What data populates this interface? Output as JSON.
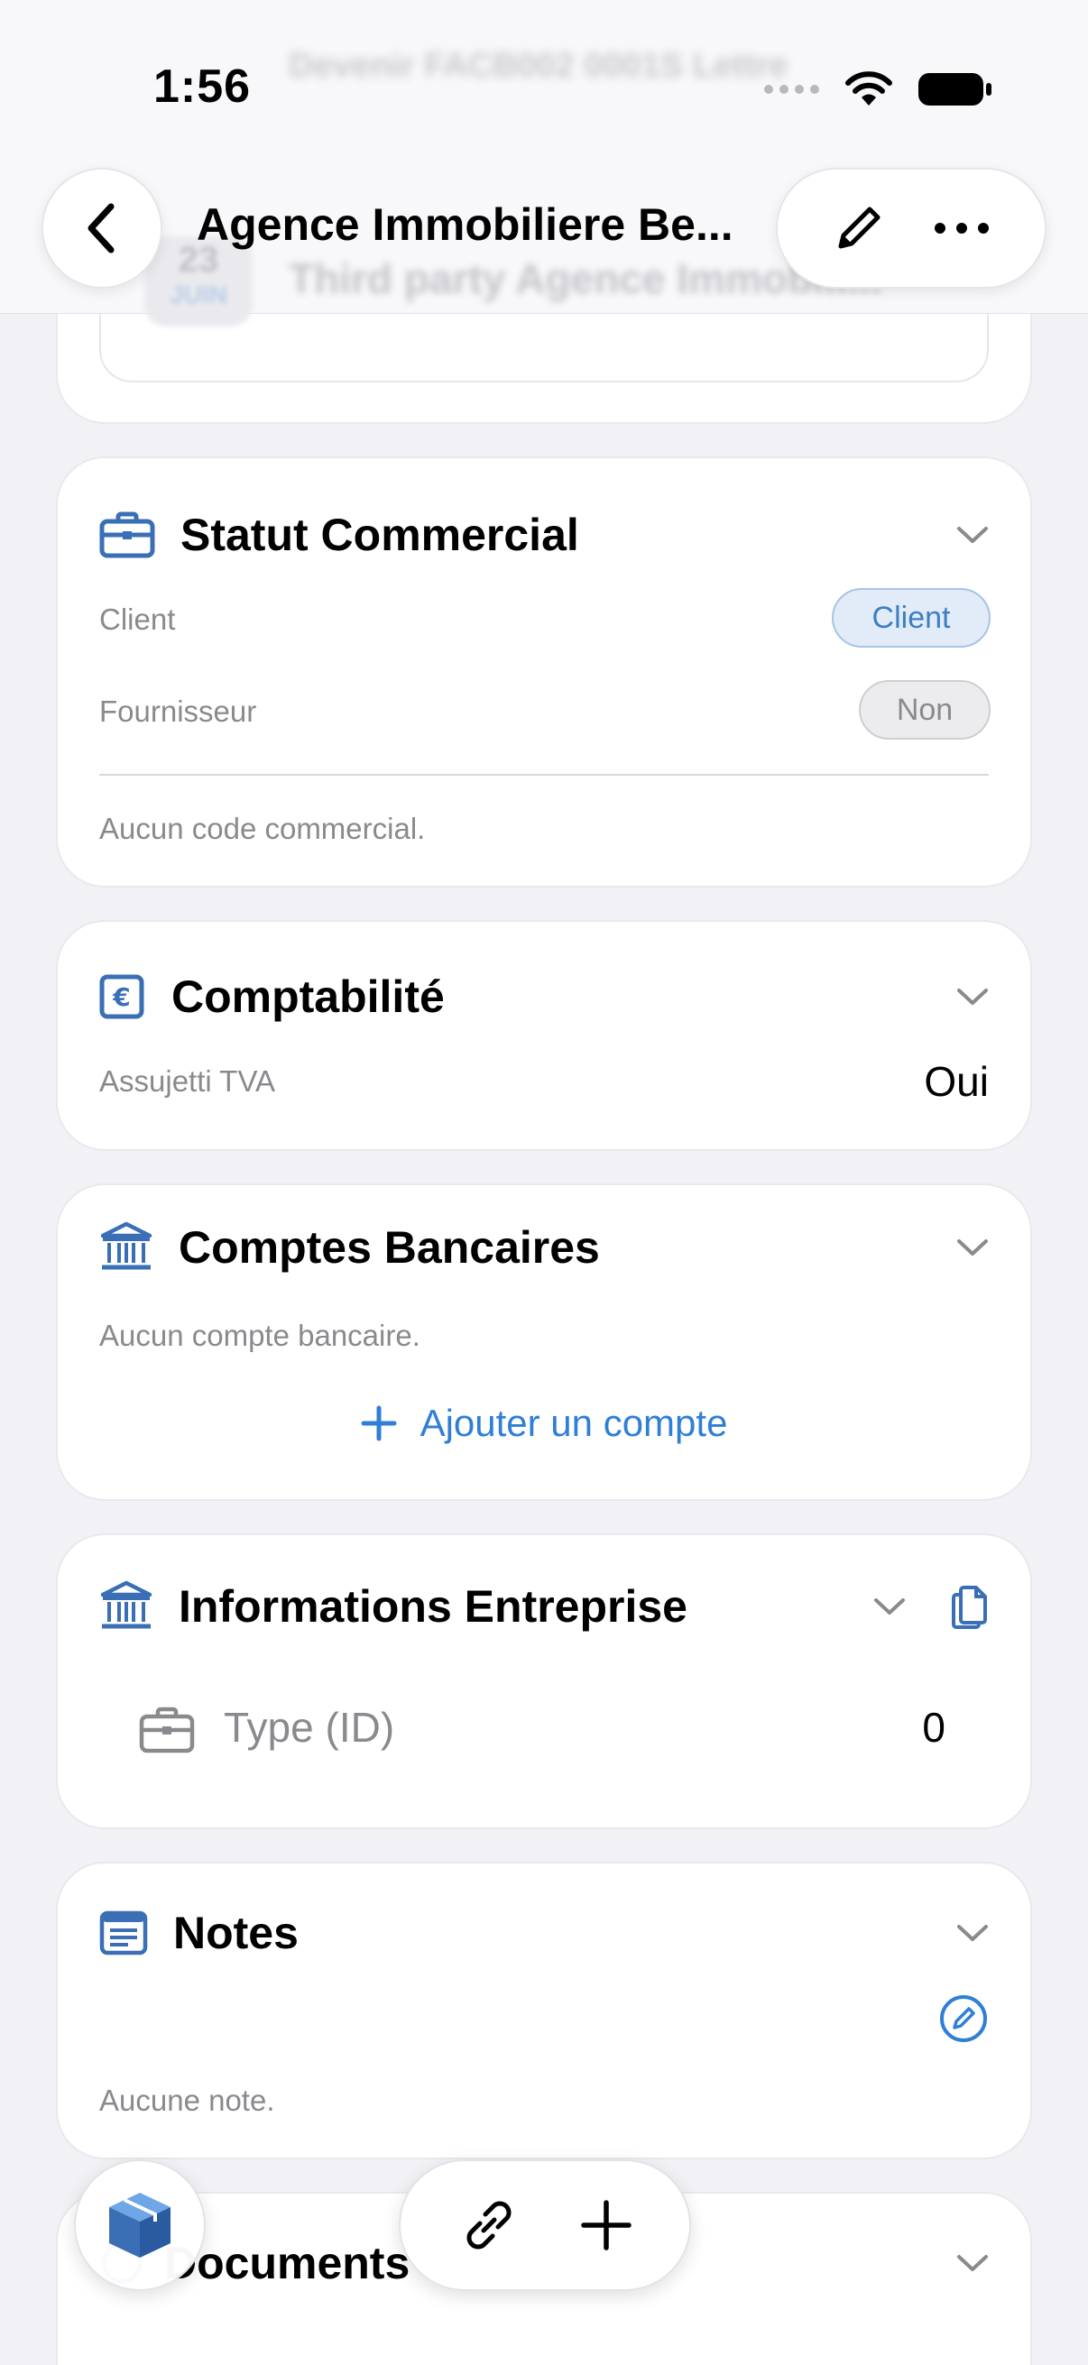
{
  "status_bar": {
    "time": "1:56"
  },
  "header": {
    "title": "Agence Immobiliere Be...",
    "ghost_line1": "Devenir FACB002 0001S Lettre",
    "ghost_line2": "Third party Agence Immobili...",
    "ghost_date_day": "23",
    "ghost_date_month": "JUIN"
  },
  "commercial": {
    "title": "Statut Commercial",
    "client_label": "Client",
    "client_value": "Client",
    "supplier_label": "Fournisseur",
    "supplier_value": "Non",
    "note": "Aucun code commercial."
  },
  "accounting": {
    "title": "Comptabilité",
    "vat_label": "Assujetti TVA",
    "vat_value": "Oui"
  },
  "bank": {
    "title": "Comptes Bancaires",
    "empty": "Aucun compte bancaire.",
    "add_label": "Ajouter un compte"
  },
  "company": {
    "title": "Informations Entreprise",
    "type_label": "Type (ID)",
    "type_value": "0"
  },
  "notes": {
    "title": "Notes",
    "empty": "Aucune note."
  },
  "documents": {
    "title": "Documents"
  },
  "colors": {
    "accent": "#2f7fd6",
    "icon_blue": "#3a6fb6",
    "background": "#f2f2f6"
  }
}
